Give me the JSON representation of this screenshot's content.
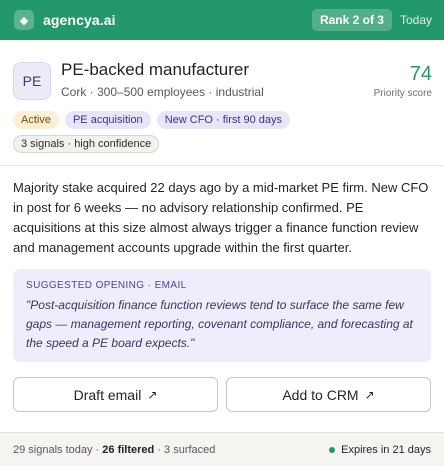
{
  "header": {
    "brand": "agencya.ai",
    "rank": "Rank 2 of 3",
    "today": "Today",
    "logo_icon": "diamond-icon"
  },
  "company": {
    "avatar": "PE",
    "name": "PE-backed manufacturer",
    "meta": "Cork · 300–500 employees · industrial",
    "score": "74",
    "score_label": "Priority score"
  },
  "tags": {
    "active": "Active",
    "pe_acquisition": "PE acquisition",
    "new_cfo": "New CFO · first 90 days",
    "signals": "3 signals · high confidence"
  },
  "description": "Majority stake acquired 22 days ago by a mid-market PE firm. New CFO in post for 6 weeks — no advisory relationship confirmed. PE acquisitions at this size almost always trigger a finance function review and management accounts upgrade within the first quarter.",
  "opening": {
    "label": "SUGGESTED OPENING · EMAIL",
    "text": "\"Post-acquisition finance function reviews tend to surface the same few gaps — management reporting, covenant compliance, and forecasting at the speed a PE board expects.\""
  },
  "actions": {
    "draft_email": "Draft email",
    "add_crm": "Add to CRM",
    "arrow": "↗"
  },
  "footer": {
    "signals_today": "29 signals today ·",
    "filtered": "26 filtered",
    "surfaced": "· 3 surfaced",
    "expires": "Expires in 21 days"
  },
  "colors": {
    "brand_green": "#23986a",
    "active_tag": "#fbefd5",
    "purple_tag": "#e8e5f8"
  }
}
